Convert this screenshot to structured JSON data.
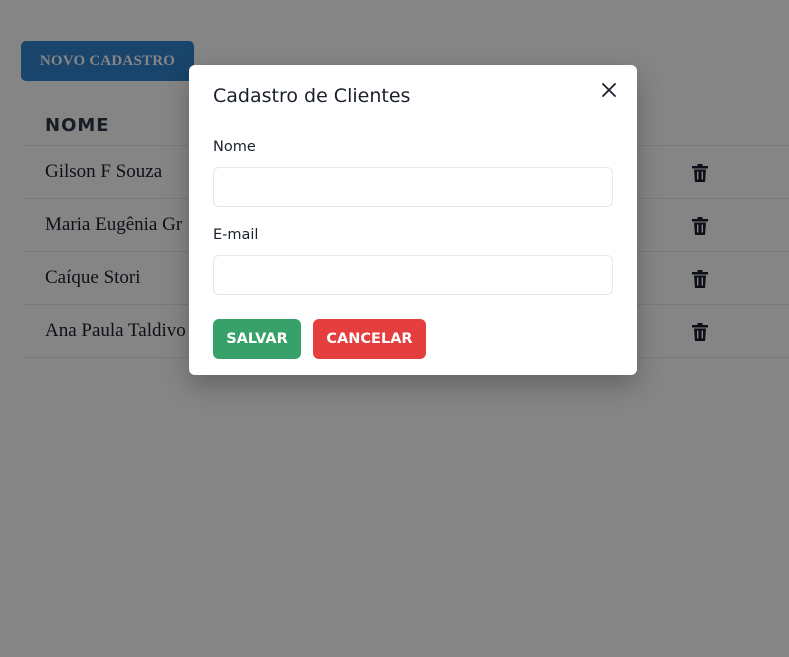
{
  "toolbar": {
    "new_label": "NOVO CADASTRO"
  },
  "table": {
    "header_name": "NOME",
    "rows": [
      {
        "name": "Gilson F Souza"
      },
      {
        "name": "Maria Eugênia Gr"
      },
      {
        "name": "Caíque Stori"
      },
      {
        "name": "Ana Paula Taldivo"
      }
    ]
  },
  "modal": {
    "title": "Cadastro de Clientes",
    "name_label": "Nome",
    "name_value": "",
    "email_label": "E-mail",
    "email_value": "",
    "save_label": "SALVAR",
    "cancel_label": "CANCELAR"
  },
  "icons": {
    "row_action": "trash-icon",
    "modal_close": "close-icon"
  },
  "colors": {
    "primary": "#3182ce",
    "save": "#38a169",
    "cancel": "#e53e3e",
    "overlay": "rgba(0,0,0,0.48)"
  }
}
